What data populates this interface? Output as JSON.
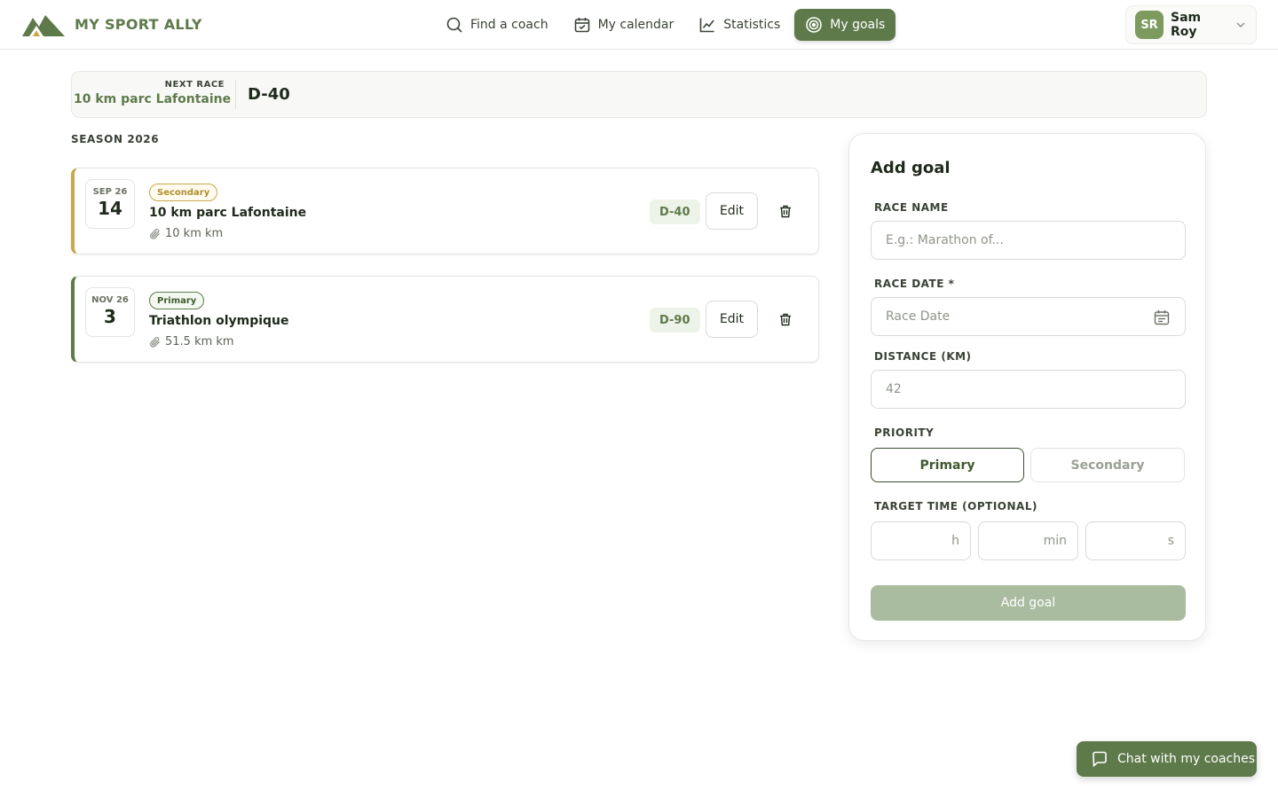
{
  "app": {
    "name": "MY SPORT ALLY"
  },
  "nav": [
    {
      "label": "Find a coach",
      "icon": "search-icon"
    },
    {
      "label": "My calendar",
      "icon": "calendar-icon"
    },
    {
      "label": "Statistics",
      "icon": "chart-line-icon"
    },
    {
      "label": "My goals",
      "icon": "target-icon",
      "active": true
    }
  ],
  "user": {
    "initials": "SR",
    "name": "Sam Roy"
  },
  "next_race": {
    "label": "NEXT RACE",
    "name": "10 km parc Lafontaine",
    "countdown": "D-40"
  },
  "season": "SEASON 2026",
  "goals": [
    {
      "month": "SEP 26",
      "day": "14",
      "priority": "Secondary",
      "title": "10 km parc Lafontaine",
      "distance": "10 km km",
      "countdown": "D-40",
      "edit": "Edit"
    },
    {
      "month": "NOV 26",
      "day": "3",
      "priority": "Primary",
      "title": "Triathlon olympique",
      "distance": "51.5 km km",
      "countdown": "D-90",
      "edit": "Edit"
    }
  ],
  "form": {
    "title": "Add goal",
    "race_name": {
      "label": "RACE NAME",
      "placeholder": "E.g.: Marathon of..."
    },
    "race_date": {
      "label": "RACE DATE *",
      "placeholder": "Race Date"
    },
    "distance": {
      "label": "DISTANCE (KM)",
      "placeholder": "42"
    },
    "priority": {
      "label": "PRIORITY",
      "options": [
        "Primary",
        "Secondary"
      ],
      "selected": "Primary"
    },
    "target_time": {
      "label": "TARGET TIME (OPTIONAL)",
      "units": [
        "h",
        "min",
        "s"
      ]
    },
    "submit": "Add goal"
  },
  "chat": {
    "label": "Chat with my coaches"
  },
  "colors": {
    "brand": "#5e7a4b",
    "secondary_accent": "#c9a84a",
    "disabled": "#a9bca0"
  }
}
